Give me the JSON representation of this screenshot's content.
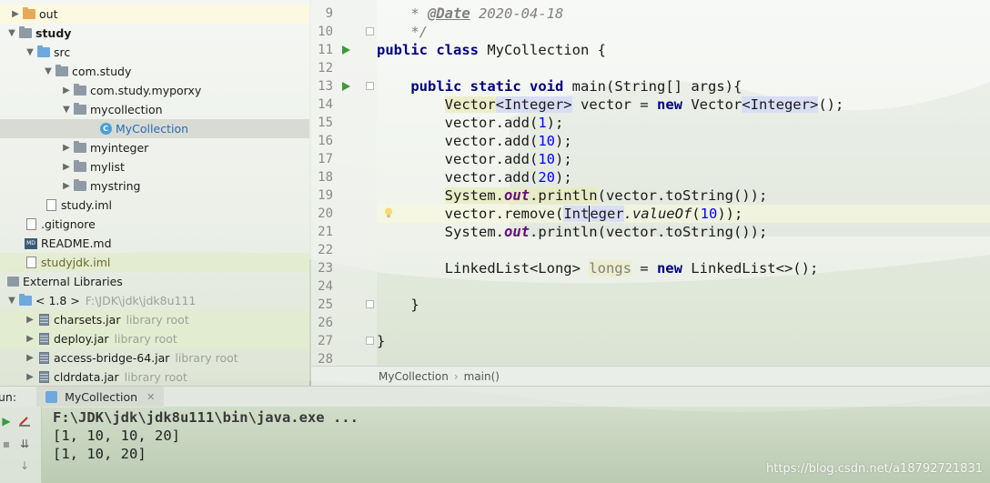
{
  "project_tree": {
    "items": [
      {
        "label": "out"
      },
      {
        "label": "study"
      },
      {
        "label": "src"
      },
      {
        "label": "com.study"
      },
      {
        "label": "com.study.myporxy"
      },
      {
        "label": "mycollection"
      },
      {
        "label": "MyCollection"
      },
      {
        "label": "myinteger"
      },
      {
        "label": "mylist"
      },
      {
        "label": "mystring"
      },
      {
        "label": "study.iml"
      },
      {
        "label": ".gitignore"
      },
      {
        "label": "README.md"
      },
      {
        "label": "studyjdk.iml"
      },
      {
        "label": "External Libraries"
      },
      {
        "label": "< 1.8 >",
        "path": "F:\\JDK\\jdk\\jdk8u111"
      },
      {
        "label": "charsets.jar",
        "suffix": "library root"
      },
      {
        "label": "deploy.jar",
        "suffix": "library root"
      },
      {
        "label": "access-bridge-64.jar",
        "suffix": "library root"
      },
      {
        "label": "cldrdata.jar",
        "suffix": "library root"
      }
    ]
  },
  "editor": {
    "line_numbers": [
      "9",
      "10",
      "11",
      "12",
      "13",
      "14",
      "15",
      "16",
      "17",
      "18",
      "19",
      "20",
      "21",
      "22",
      "23",
      "24",
      "25",
      "26",
      "27",
      "28"
    ],
    "current_line": "20",
    "breadcrumb": {
      "class_name": "MyCollection",
      "method_name": "main()"
    }
  },
  "run_panel": {
    "label": "un:",
    "tab_label": "MyCollection",
    "output": [
      "F:\\JDK\\jdk\\jdk8u111\\bin\\java.exe ...",
      "[1, 10, 10, 20]",
      "[1, 10, 20]"
    ]
  },
  "watermark": "https://blog.csdn.net/a18792721831",
  "colors": {
    "keyword": "#00007f",
    "number": "#0000ff",
    "static_field": "#660e7a",
    "run_icon": "#3c9a3c"
  }
}
